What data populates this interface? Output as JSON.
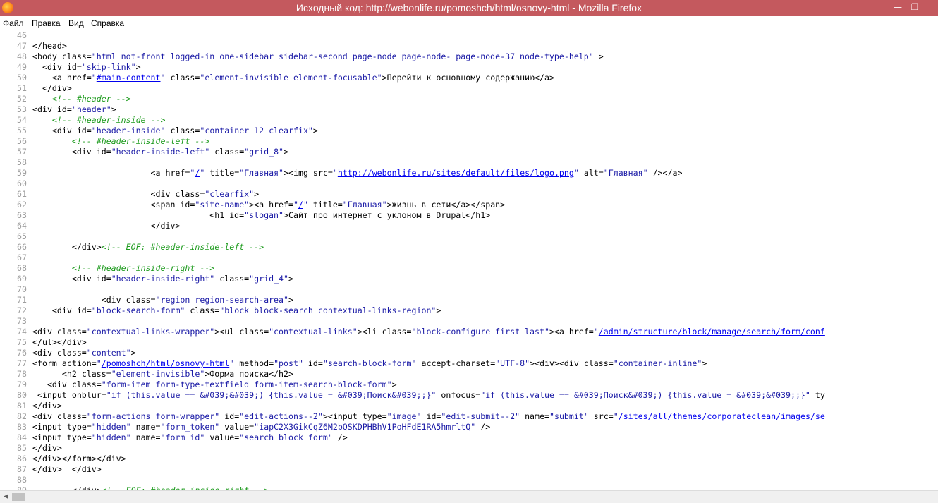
{
  "window": {
    "title": "Исходный код: http://webonlife.ru/pomoshch/html/osnovy-html - Mozilla Firefox",
    "minimize_glyph": "—",
    "restore_glyph": "❐",
    "icon": "firefox-icon"
  },
  "menu": [
    "Файл",
    "Правка",
    "Вид",
    "Справка"
  ],
  "colors": {
    "titlebar": "#c4595e",
    "line_number": "#9e9e9e",
    "attr_value": "#1a1aa6",
    "link": "#0000ee",
    "comment": "#1e9b1e"
  },
  "code_lines": [
    {
      "n": "46",
      "segs": []
    },
    {
      "n": "47",
      "segs": [
        {
          "t": "</head>",
          "c": "tag"
        }
      ]
    },
    {
      "n": "48",
      "segs": [
        {
          "t": "<body ",
          "c": "tag"
        },
        {
          "t": "class=",
          "c": "attr"
        },
        {
          "t": "\"html not-front logged-in one-sidebar sidebar-second page-node page-node- page-node-37 node-type-help\"",
          "c": "val"
        },
        {
          "t": " >",
          "c": "tag"
        }
      ]
    },
    {
      "n": "49",
      "segs": [
        {
          "t": "  <div ",
          "c": "tag"
        },
        {
          "t": "id=",
          "c": "attr"
        },
        {
          "t": "\"skip-link\"",
          "c": "val"
        },
        {
          "t": ">",
          "c": "tag"
        }
      ]
    },
    {
      "n": "50",
      "segs": [
        {
          "t": "    <a ",
          "c": "tag"
        },
        {
          "t": "href=",
          "c": "attr"
        },
        {
          "t": "\"",
          "c": "val"
        },
        {
          "t": "#main-content",
          "c": "link"
        },
        {
          "t": "\"",
          "c": "val"
        },
        {
          "t": " class=",
          "c": "attr"
        },
        {
          "t": "\"element-invisible element-focusable\"",
          "c": "val"
        },
        {
          "t": ">Перейти к основному содержанию</a>",
          "c": "tag"
        }
      ]
    },
    {
      "n": "51",
      "segs": [
        {
          "t": "  </div>",
          "c": "tag"
        }
      ]
    },
    {
      "n": "52",
      "segs": [
        {
          "t": "    ",
          "c": "tag"
        },
        {
          "t": "<!-- #header -->",
          "c": "cmt"
        }
      ]
    },
    {
      "n": "53",
      "segs": [
        {
          "t": "<div ",
          "c": "tag"
        },
        {
          "t": "id=",
          "c": "attr"
        },
        {
          "t": "\"header\"",
          "c": "val"
        },
        {
          "t": ">",
          "c": "tag"
        }
      ]
    },
    {
      "n": "54",
      "segs": [
        {
          "t": "    ",
          "c": "tag"
        },
        {
          "t": "<!-- #header-inside -->",
          "c": "cmt"
        }
      ]
    },
    {
      "n": "55",
      "segs": [
        {
          "t": "    <div ",
          "c": "tag"
        },
        {
          "t": "id=",
          "c": "attr"
        },
        {
          "t": "\"header-inside\"",
          "c": "val"
        },
        {
          "t": " class=",
          "c": "attr"
        },
        {
          "t": "\"container_12 clearfix\"",
          "c": "val"
        },
        {
          "t": ">",
          "c": "tag"
        }
      ]
    },
    {
      "n": "56",
      "segs": [
        {
          "t": "        ",
          "c": "tag"
        },
        {
          "t": "<!-- #header-inside-left -->",
          "c": "cmt"
        }
      ]
    },
    {
      "n": "57",
      "segs": [
        {
          "t": "        <div ",
          "c": "tag"
        },
        {
          "t": "id=",
          "c": "attr"
        },
        {
          "t": "\"header-inside-left\"",
          "c": "val"
        },
        {
          "t": " class=",
          "c": "attr"
        },
        {
          "t": "\"grid_8\"",
          "c": "val"
        },
        {
          "t": ">",
          "c": "tag"
        }
      ]
    },
    {
      "n": "58",
      "segs": []
    },
    {
      "n": "59",
      "segs": [
        {
          "t": "                        <a ",
          "c": "tag"
        },
        {
          "t": "href=",
          "c": "attr"
        },
        {
          "t": "\"",
          "c": "val"
        },
        {
          "t": "/",
          "c": "link"
        },
        {
          "t": "\"",
          "c": "val"
        },
        {
          "t": " title=",
          "c": "attr"
        },
        {
          "t": "\"Главная\"",
          "c": "val"
        },
        {
          "t": "><img ",
          "c": "tag"
        },
        {
          "t": "src=",
          "c": "attr"
        },
        {
          "t": "\"",
          "c": "val"
        },
        {
          "t": "http://webonlife.ru/sites/default/files/logo.png",
          "c": "link"
        },
        {
          "t": "\"",
          "c": "val"
        },
        {
          "t": " alt=",
          "c": "attr"
        },
        {
          "t": "\"Главная\"",
          "c": "val"
        },
        {
          "t": " /></a>",
          "c": "tag"
        }
      ]
    },
    {
      "n": "60",
      "segs": []
    },
    {
      "n": "61",
      "segs": [
        {
          "t": "                        <div ",
          "c": "tag"
        },
        {
          "t": "class=",
          "c": "attr"
        },
        {
          "t": "\"clearfix\"",
          "c": "val"
        },
        {
          "t": ">",
          "c": "tag"
        }
      ]
    },
    {
      "n": "62",
      "segs": [
        {
          "t": "                        <span ",
          "c": "tag"
        },
        {
          "t": "id=",
          "c": "attr"
        },
        {
          "t": "\"site-name\"",
          "c": "val"
        },
        {
          "t": "><a ",
          "c": "tag"
        },
        {
          "t": "href=",
          "c": "attr"
        },
        {
          "t": "\"",
          "c": "val"
        },
        {
          "t": "/",
          "c": "link"
        },
        {
          "t": "\"",
          "c": "val"
        },
        {
          "t": " title=",
          "c": "attr"
        },
        {
          "t": "\"Главная\"",
          "c": "val"
        },
        {
          "t": ">жизнь в сети</a></span>",
          "c": "tag"
        }
      ]
    },
    {
      "n": "63",
      "segs": [
        {
          "t": "                                    <h1 ",
          "c": "tag"
        },
        {
          "t": "id=",
          "c": "attr"
        },
        {
          "t": "\"slogan\"",
          "c": "val"
        },
        {
          "t": ">Сайт про интернет с уклоном в Drupal</h1>",
          "c": "tag"
        }
      ]
    },
    {
      "n": "64",
      "segs": [
        {
          "t": "                        </div>",
          "c": "tag"
        }
      ]
    },
    {
      "n": "65",
      "segs": []
    },
    {
      "n": "66",
      "segs": [
        {
          "t": "        </div>",
          "c": "tag"
        },
        {
          "t": "<!-- EOF: #header-inside-left -->",
          "c": "cmt"
        }
      ]
    },
    {
      "n": "67",
      "segs": []
    },
    {
      "n": "68",
      "segs": [
        {
          "t": "        ",
          "c": "tag"
        },
        {
          "t": "<!-- #header-inside-right -->",
          "c": "cmt"
        }
      ]
    },
    {
      "n": "69",
      "segs": [
        {
          "t": "        <div ",
          "c": "tag"
        },
        {
          "t": "id=",
          "c": "attr"
        },
        {
          "t": "\"header-inside-right\"",
          "c": "val"
        },
        {
          "t": " class=",
          "c": "attr"
        },
        {
          "t": "\"grid_4\"",
          "c": "val"
        },
        {
          "t": ">",
          "c": "tag"
        }
      ]
    },
    {
      "n": "70",
      "segs": []
    },
    {
      "n": "71",
      "segs": [
        {
          "t": "              <div ",
          "c": "tag"
        },
        {
          "t": "class=",
          "c": "attr"
        },
        {
          "t": "\"region region-search-area\"",
          "c": "val"
        },
        {
          "t": ">",
          "c": "tag"
        }
      ]
    },
    {
      "n": "72",
      "segs": [
        {
          "t": "    <div ",
          "c": "tag"
        },
        {
          "t": "id=",
          "c": "attr"
        },
        {
          "t": "\"block-search-form\"",
          "c": "val"
        },
        {
          "t": " class=",
          "c": "attr"
        },
        {
          "t": "\"block block-search contextual-links-region\"",
          "c": "val"
        },
        {
          "t": ">",
          "c": "tag"
        }
      ]
    },
    {
      "n": "73",
      "segs": []
    },
    {
      "n": "74",
      "segs": [
        {
          "t": "<div ",
          "c": "tag"
        },
        {
          "t": "class=",
          "c": "attr"
        },
        {
          "t": "\"contextual-links-wrapper\"",
          "c": "val"
        },
        {
          "t": "><ul ",
          "c": "tag"
        },
        {
          "t": "class=",
          "c": "attr"
        },
        {
          "t": "\"contextual-links\"",
          "c": "val"
        },
        {
          "t": "><li ",
          "c": "tag"
        },
        {
          "t": "class=",
          "c": "attr"
        },
        {
          "t": "\"block-configure first last\"",
          "c": "val"
        },
        {
          "t": "><a ",
          "c": "tag"
        },
        {
          "t": "href=",
          "c": "attr"
        },
        {
          "t": "\"",
          "c": "val"
        },
        {
          "t": "/admin/structure/block/manage/search/form/conf",
          "c": "link"
        }
      ]
    },
    {
      "n": "75",
      "segs": [
        {
          "t": "</ul></div>",
          "c": "tag"
        }
      ]
    },
    {
      "n": "76",
      "segs": [
        {
          "t": "<div ",
          "c": "tag"
        },
        {
          "t": "class=",
          "c": "attr"
        },
        {
          "t": "\"content\"",
          "c": "val"
        },
        {
          "t": ">",
          "c": "tag"
        }
      ]
    },
    {
      "n": "77",
      "segs": [
        {
          "t": "<form ",
          "c": "tag"
        },
        {
          "t": "action=",
          "c": "attr"
        },
        {
          "t": "\"",
          "c": "val"
        },
        {
          "t": "/pomoshch/html/osnovy-html",
          "c": "link"
        },
        {
          "t": "\"",
          "c": "val"
        },
        {
          "t": " method=",
          "c": "attr"
        },
        {
          "t": "\"post\"",
          "c": "val"
        },
        {
          "t": " id=",
          "c": "attr"
        },
        {
          "t": "\"search-block-form\"",
          "c": "val"
        },
        {
          "t": " accept-charset=",
          "c": "attr"
        },
        {
          "t": "\"UTF-8\"",
          "c": "val"
        },
        {
          "t": "><div><div ",
          "c": "tag"
        },
        {
          "t": "class=",
          "c": "attr"
        },
        {
          "t": "\"container-inline\"",
          "c": "val"
        },
        {
          "t": ">",
          "c": "tag"
        }
      ]
    },
    {
      "n": "78",
      "segs": [
        {
          "t": "      <h2 ",
          "c": "tag"
        },
        {
          "t": "class=",
          "c": "attr"
        },
        {
          "t": "\"element-invisible\"",
          "c": "val"
        },
        {
          "t": ">Форма поиска</h2>",
          "c": "tag"
        }
      ]
    },
    {
      "n": "79",
      "segs": [
        {
          "t": "   <div ",
          "c": "tag"
        },
        {
          "t": "class=",
          "c": "attr"
        },
        {
          "t": "\"form-item form-type-textfield form-item-search-block-form\"",
          "c": "val"
        },
        {
          "t": ">",
          "c": "tag"
        }
      ]
    },
    {
      "n": "80",
      "segs": [
        {
          "t": " <input ",
          "c": "tag"
        },
        {
          "t": "onblur=",
          "c": "attr"
        },
        {
          "t": "\"if (this.value == &#039;&#039;) {this.value = &#039;Поиск&#039;;}\"",
          "c": "val"
        },
        {
          "t": " onfocus=",
          "c": "attr"
        },
        {
          "t": "\"if (this.value == &#039;Поиск&#039;) {this.value = &#039;&#039;;}\"",
          "c": "val"
        },
        {
          "t": " ty",
          "c": "attr"
        }
      ]
    },
    {
      "n": "81",
      "segs": [
        {
          "t": "</div>",
          "c": "tag"
        }
      ]
    },
    {
      "n": "82",
      "segs": [
        {
          "t": "<div ",
          "c": "tag"
        },
        {
          "t": "class=",
          "c": "attr"
        },
        {
          "t": "\"form-actions form-wrapper\"",
          "c": "val"
        },
        {
          "t": " id=",
          "c": "attr"
        },
        {
          "t": "\"edit-actions--2\"",
          "c": "val"
        },
        {
          "t": "><input ",
          "c": "tag"
        },
        {
          "t": "type=",
          "c": "attr"
        },
        {
          "t": "\"image\"",
          "c": "val"
        },
        {
          "t": " id=",
          "c": "attr"
        },
        {
          "t": "\"edit-submit--2\"",
          "c": "val"
        },
        {
          "t": " name=",
          "c": "attr"
        },
        {
          "t": "\"submit\"",
          "c": "val"
        },
        {
          "t": " src=",
          "c": "attr"
        },
        {
          "t": "\"",
          "c": "val"
        },
        {
          "t": "/sites/all/themes/corporateclean/images/se",
          "c": "link"
        }
      ]
    },
    {
      "n": "83",
      "segs": [
        {
          "t": "<input ",
          "c": "tag"
        },
        {
          "t": "type=",
          "c": "attr"
        },
        {
          "t": "\"hidden\"",
          "c": "val"
        },
        {
          "t": " name=",
          "c": "attr"
        },
        {
          "t": "\"form_token\"",
          "c": "val"
        },
        {
          "t": " value=",
          "c": "attr"
        },
        {
          "t": "\"iapC2X3GikCqZ6M2bQSKDPHBhV1PoHFdE1RA5hmrltQ\"",
          "c": "val"
        },
        {
          "t": " />",
          "c": "tag"
        }
      ]
    },
    {
      "n": "84",
      "segs": [
        {
          "t": "<input ",
          "c": "tag"
        },
        {
          "t": "type=",
          "c": "attr"
        },
        {
          "t": "\"hidden\"",
          "c": "val"
        },
        {
          "t": " name=",
          "c": "attr"
        },
        {
          "t": "\"form_id\"",
          "c": "val"
        },
        {
          "t": " value=",
          "c": "attr"
        },
        {
          "t": "\"search_block_form\"",
          "c": "val"
        },
        {
          "t": " />",
          "c": "tag"
        }
      ]
    },
    {
      "n": "85",
      "segs": [
        {
          "t": "</div>",
          "c": "tag"
        }
      ]
    },
    {
      "n": "86",
      "segs": [
        {
          "t": "</div></form></div>",
          "c": "tag"
        }
      ]
    },
    {
      "n": "87",
      "segs": [
        {
          "t": "</div>  </div>",
          "c": "tag"
        }
      ]
    },
    {
      "n": "88",
      "segs": []
    },
    {
      "n": "89",
      "segs": [
        {
          "t": "        </div>",
          "c": "tag"
        },
        {
          "t": "<!-- EOF: #header-inside-right -->",
          "c": "cmt"
        }
      ]
    }
  ]
}
